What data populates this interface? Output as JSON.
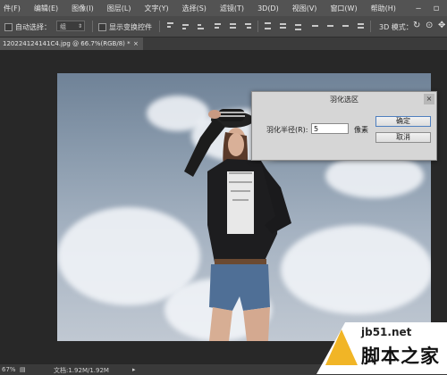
{
  "menubar": {
    "items": [
      "件(F)",
      "编辑(E)",
      "图像(I)",
      "图层(L)",
      "文字(Y)",
      "选择(S)",
      "滤镜(T)",
      "3D(D)",
      "视图(V)",
      "窗口(W)",
      "帮助(H)"
    ]
  },
  "optionsbar": {
    "auto_select_label": "自动选择：",
    "auto_select_value": "组",
    "show_transform_label": "显示变换控件",
    "mode_3d_label": "3D 模式："
  },
  "document_tab": {
    "title": "120224124141C4.jpg @ 66.7%(RGB/8) *",
    "close": "×"
  },
  "dialog": {
    "title": "羽化选区",
    "radius_label": "羽化半径(R):",
    "radius_value": "5",
    "unit": "像素",
    "ok_label": "确定",
    "cancel_label": "取消",
    "close": "×"
  },
  "statusbar": {
    "zoom": "67%",
    "doc_info": "文档:1.92M/1.92M"
  },
  "watermark": {
    "url": "jb51.net",
    "name": "脚本之家"
  },
  "colors": {
    "app_background": "#282828",
    "menubar": "#535353",
    "optionsbar": "#4a4a4a",
    "dialog": "#d6d6d6",
    "watermark_accent": "#f1b526"
  }
}
